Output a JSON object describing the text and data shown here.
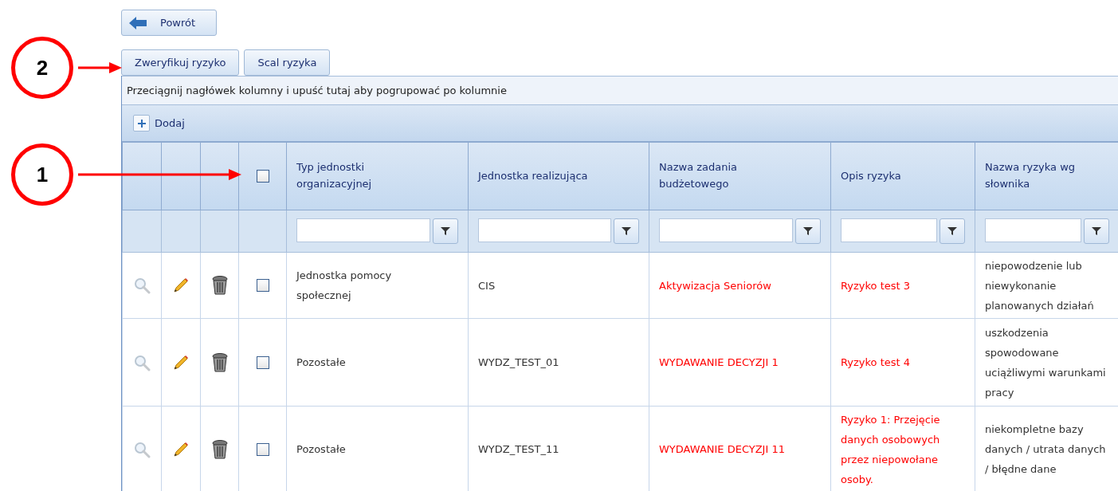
{
  "back_button": {
    "label": "Powrót"
  },
  "actions": [
    {
      "label": "Zweryfikuj ryzyko"
    },
    {
      "label": "Scal ryzyka"
    }
  ],
  "annotations": [
    {
      "label": "2"
    },
    {
      "label": "1"
    }
  ],
  "group_panel": {
    "text": "Przeciągnij nagłówek kolumny i upuść tutaj aby pogrupować po kolumnie"
  },
  "toolbar": {
    "add_label": "Dodaj"
  },
  "grid": {
    "header_checked": false,
    "columns": [
      {
        "title": "Typ jednostki organizacyjnej",
        "highlighted": false
      },
      {
        "title": "Jednostka realizująca",
        "highlighted": false
      },
      {
        "title": "Nazwa zadania budżetowego",
        "highlighted": true
      },
      {
        "title": "Opis ryzyka",
        "highlighted": true
      },
      {
        "title": "Nazwa ryzyka wg słownika",
        "highlighted": false
      }
    ],
    "rows": [
      {
        "checked": false,
        "cells": [
          "Jednostka pomocy społecznej",
          "CIS",
          "Aktywizacja Seniorów",
          "Ryzyko test 3",
          "niepowodzenie lub niewykonanie planowanych działań"
        ]
      },
      {
        "checked": false,
        "cells": [
          "Pozostałe",
          "WYDZ_TEST_01",
          "WYDAWANIE DECYZJI 1",
          "Ryzyko test 4",
          "uszkodzenia spowodowane uciążliwymi warunkami pracy"
        ]
      },
      {
        "checked": false,
        "cells": [
          "Pozostałe",
          "WYDZ_TEST_11",
          "WYDAWANIE DECYZJI 11",
          "Ryzyko 1: Przejęcie danych osobowych przez niepowołane osoby.",
          "niekompletne bazy danych / utrata danych / błędne dane"
        ]
      }
    ]
  }
}
